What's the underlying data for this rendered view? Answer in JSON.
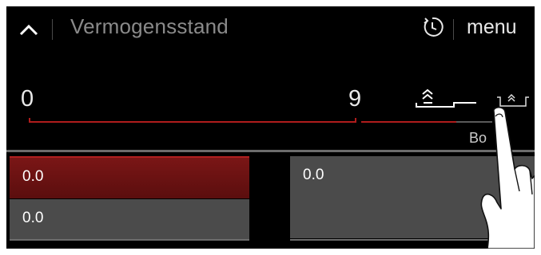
{
  "header": {
    "title": "Vermogensstand",
    "menu_label": "menu",
    "icons": [
      "chevron-up-icon",
      "timer-icon"
    ]
  },
  "scale": {
    "min_label": "0",
    "max_label": "9",
    "end_label": "Bo",
    "icons": [
      "boost-level-icon",
      "bridge-zone-icon"
    ],
    "colors": {
      "active": "#b01c1c",
      "inactive": "#5a5a5a"
    }
  },
  "values": {
    "left_top": "0.0",
    "left_bottom": "0.0",
    "right": "0.0"
  }
}
